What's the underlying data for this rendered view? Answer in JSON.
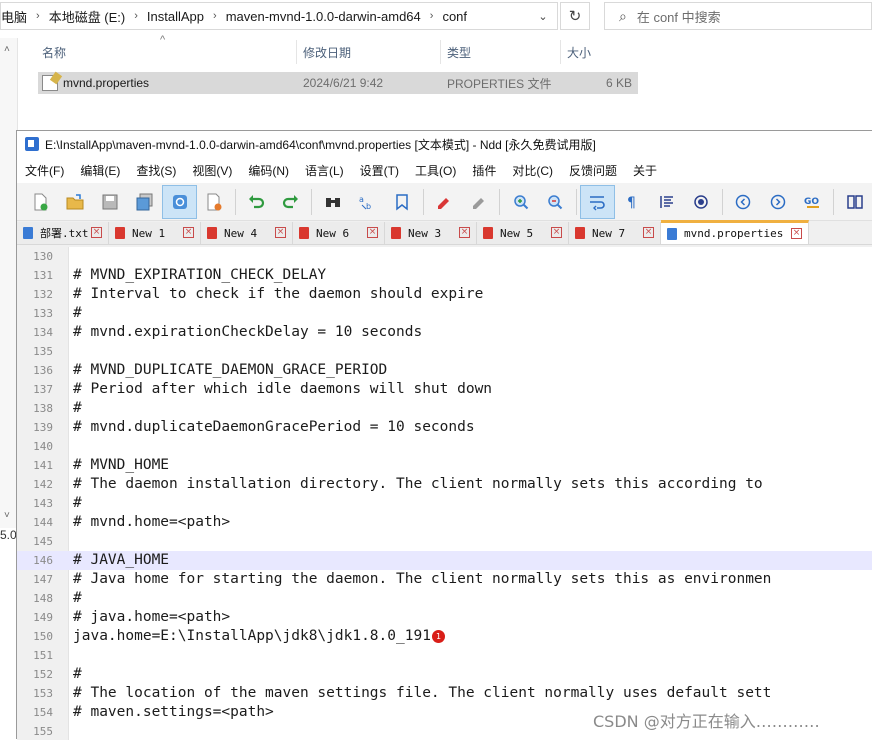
{
  "explorer": {
    "breadcrumb": [
      "电脑",
      "本地磁盘 (E:)",
      "InstallApp",
      "maven-mvnd-1.0.0-darwin-amd64",
      "conf"
    ],
    "search_placeholder": "在 conf 中搜索",
    "columns": {
      "name": "名称",
      "date": "修改日期",
      "type": "类型",
      "size": "大小"
    },
    "file": {
      "name": "mvnd.properties",
      "date": "2024/6/21 9:42",
      "type": "PROPERTIES 文件",
      "size": "6 KB"
    },
    "left_sliver": "5.0"
  },
  "editor": {
    "title": "E:\\InstallApp\\maven-mvnd-1.0.0-darwin-amd64\\conf\\mvnd.properties [文本模式] - Ndd [永久免费试用版]",
    "menu": [
      "文件(F)",
      "编辑(E)",
      "查找(S)",
      "视图(V)",
      "编码(N)",
      "语言(L)",
      "设置(T)",
      "工具(O)",
      "插件",
      "对比(C)",
      "反馈问题",
      "关于"
    ],
    "tabs": [
      {
        "label": "部署.txt",
        "color": "#3a7bd5"
      },
      {
        "label": "New 1",
        "color": "#d9382f"
      },
      {
        "label": "New 4",
        "color": "#d9382f"
      },
      {
        "label": "New 6",
        "color": "#d9382f"
      },
      {
        "label": "New 3",
        "color": "#d9382f"
      },
      {
        "label": "New 5",
        "color": "#d9382f"
      },
      {
        "label": "New 7",
        "color": "#d9382f"
      },
      {
        "label": "mvnd.properties",
        "color": "#3a7bd5"
      }
    ],
    "active_tab": 7,
    "highlight_line": "146",
    "marker_line": "150",
    "marker_label": "1",
    "lines": [
      {
        "n": "130",
        "t": ""
      },
      {
        "n": "131",
        "t": "# MVND_EXPIRATION_CHECK_DELAY"
      },
      {
        "n": "132",
        "t": "# Interval to check if the daemon should expire"
      },
      {
        "n": "133",
        "t": "#"
      },
      {
        "n": "134",
        "t": "# mvnd.expirationCheckDelay = 10 seconds"
      },
      {
        "n": "135",
        "t": ""
      },
      {
        "n": "136",
        "t": "# MVND_DUPLICATE_DAEMON_GRACE_PERIOD"
      },
      {
        "n": "137",
        "t": "# Period after which idle daemons will shut down"
      },
      {
        "n": "138",
        "t": "#"
      },
      {
        "n": "139",
        "t": "# mvnd.duplicateDaemonGracePeriod = 10 seconds"
      },
      {
        "n": "140",
        "t": ""
      },
      {
        "n": "141",
        "t": "# MVND_HOME"
      },
      {
        "n": "142",
        "t": "# The daemon installation directory. The client normally sets this according to"
      },
      {
        "n": "143",
        "t": "#"
      },
      {
        "n": "144",
        "t": "# mvnd.home=<path>"
      },
      {
        "n": "145",
        "t": ""
      },
      {
        "n": "146",
        "t": "# JAVA_HOME"
      },
      {
        "n": "147",
        "t": "# Java home for starting the daemon. The client normally sets this as environmen"
      },
      {
        "n": "148",
        "t": "#"
      },
      {
        "n": "149",
        "t": "# java.home=<path>"
      },
      {
        "n": "150",
        "t": "java.home=E:\\InstallApp\\jdk8\\jdk1.8.0_191"
      },
      {
        "n": "151",
        "t": ""
      },
      {
        "n": "152",
        "t": "#"
      },
      {
        "n": "153",
        "t": "# The location of the maven settings file. The client normally uses default sett"
      },
      {
        "n": "154",
        "t": "# maven.settings=<path>"
      },
      {
        "n": "155",
        "t": ""
      }
    ]
  },
  "watermark": "CSDN @对方正在输入…………"
}
